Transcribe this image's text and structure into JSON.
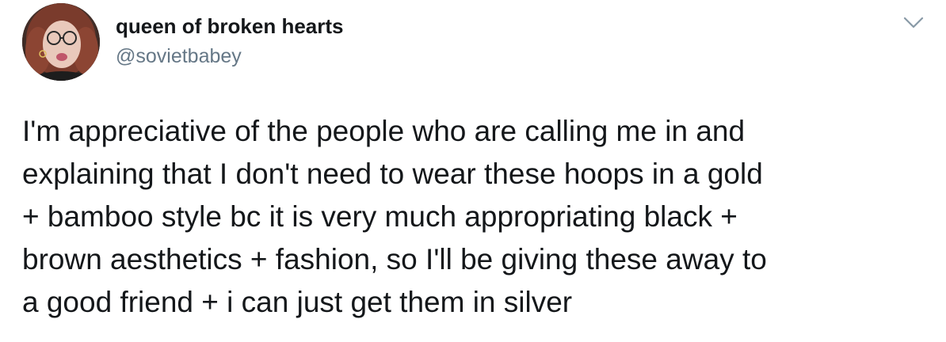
{
  "tweet": {
    "author": {
      "display_name": "queen of broken hearts",
      "handle": "@sovietbabey"
    },
    "menu_icon": "chevron-down-icon",
    "text": "I'm appreciative of the people who are calling me in and\nexplaining that I don't need to wear these hoops in a gold\n+ bamboo style bc it is very much appropriating black +\nbrown aesthetics + fashion, so I'll be giving these away to\na good friend + i can just get them in silver"
  },
  "colors": {
    "text": "#14171a",
    "secondary_text": "#657786",
    "chevron": "#8899a6"
  }
}
